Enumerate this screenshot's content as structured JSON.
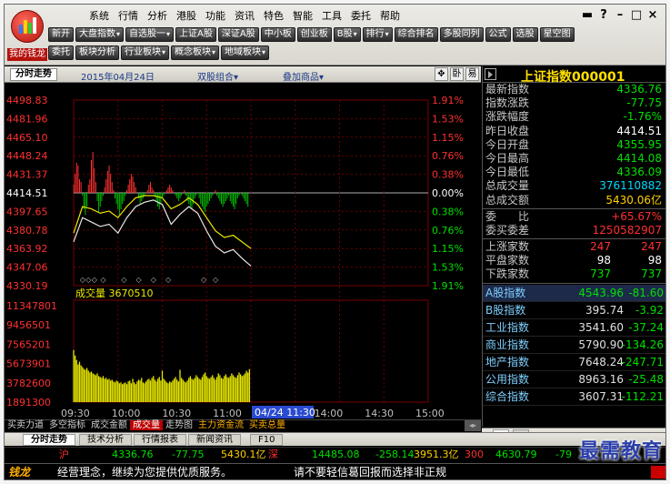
{
  "app": {
    "logo_label": "我的钱龙",
    "menu": [
      "系统",
      "行情",
      "分析",
      "港股",
      "功能",
      "资讯",
      "特色",
      "智能",
      "工具",
      "委托",
      "帮助"
    ],
    "window_controls": [
      "▬",
      "?",
      "–",
      "□",
      "×"
    ]
  },
  "toolbar": {
    "row1": [
      {
        "label": "新开",
        "dd": false
      },
      {
        "label": "大盘指数",
        "dd": true
      },
      {
        "label": "自选股一",
        "dd": true
      },
      {
        "label": "上证A股",
        "dd": false
      },
      {
        "label": "深证A股",
        "dd": false
      },
      {
        "label": "中小板",
        "dd": false
      },
      {
        "label": "创业板",
        "dd": false
      },
      {
        "label": "B股",
        "dd": true
      },
      {
        "label": "排行",
        "dd": true
      },
      {
        "label": "综合排名",
        "dd": false
      },
      {
        "label": "多股同列",
        "dd": false
      },
      {
        "label": "公式",
        "dd": false
      },
      {
        "label": "选股",
        "dd": false
      },
      {
        "label": "星空图",
        "dd": false
      }
    ],
    "row2": [
      {
        "label": "委托",
        "dd": false
      },
      {
        "label": "板块分析",
        "dd": false
      },
      {
        "label": "行业板块",
        "dd": true
      },
      {
        "label": "概念板块",
        "dd": true
      },
      {
        "label": "地域板块",
        "dd": true
      }
    ]
  },
  "chart_header": {
    "tab": "分时走势",
    "date": "2015年04月24日",
    "combo": "双股组合",
    "overlay": "叠加商品",
    "icons": [
      "✥",
      "卧",
      "易"
    ]
  },
  "chart_data": {
    "type": "line",
    "price_labels": [
      "4498.83",
      "4481.96",
      "4465.10",
      "4448.24",
      "4431.37",
      "4414.51",
      "4397.65",
      "4380.78",
      "4363.92",
      "4347.06",
      "4330.19"
    ],
    "pct_labels": [
      "1.91%",
      "1.53%",
      "1.15%",
      "0.76%",
      "0.38%",
      "0.00%",
      "0.38%",
      "0.76%",
      "1.15%",
      "1.53%",
      "1.91%"
    ],
    "volume_labels": [
      "11347801",
      "9456501",
      "7565201",
      "5673901",
      "3782600",
      "1891300"
    ],
    "volume_title": "成交量",
    "volume_value_text": "成交量 3670510",
    "x_labels": [
      "09:30",
      "10:00",
      "10:30",
      "11:00",
      "11:30",
      "14:00",
      "14:30",
      "15:00"
    ],
    "highlight_time": "04/24 11:30",
    "prev_close": 4414.51,
    "y_range": [
      4330.19,
      4498.83
    ],
    "volume_range": [
      0,
      11347801
    ],
    "colors": {
      "price": "#e8e8e8",
      "avg": "#e8e800",
      "up": "#ff3030",
      "down": "#00c000",
      "volume": "#e8e800",
      "flat": "#ffffff"
    },
    "series": [
      {
        "x": [
          0,
          6,
          12,
          18,
          24,
          30,
          36,
          42,
          48,
          54,
          60,
          66,
          72,
          78,
          84,
          90,
          96,
          102,
          108,
          114,
          120
        ],
        "values": [
          4370,
          4392,
          4388,
          4384,
          4386,
          4378,
          4392,
          4402,
          4406,
          4408,
          4404,
          4386,
          4395,
          4402,
          4396,
          4380,
          4366,
          4360,
          4363,
          4355,
          4348
        ]
      },
      {
        "x": [
          0,
          6,
          12,
          18,
          24,
          30,
          36,
          42,
          48,
          54,
          60,
          66,
          72,
          78,
          84,
          90,
          96,
          102,
          108,
          114,
          120
        ],
        "values": [
          4378,
          4402,
          4400,
          4396,
          4398,
          4392,
          4402,
          4410,
          4412,
          4412,
          4410,
          4400,
          4404,
          4410,
          4404,
          4392,
          4380,
          4374,
          4376,
          4370,
          4364
        ]
      }
    ],
    "diff_bars": [
      6,
      14,
      22,
      20,
      10,
      8,
      -2,
      -12,
      -16,
      -10,
      6,
      10,
      24,
      30,
      18,
      8,
      -6,
      -14,
      -10,
      -6,
      -2,
      4,
      10,
      16,
      20,
      14,
      8,
      2,
      -4,
      -8,
      -12,
      -16,
      -12,
      -8,
      -6,
      -2,
      2,
      6,
      10,
      14,
      12,
      8,
      4,
      0,
      -4,
      -8,
      -6,
      -4,
      -2,
      0,
      2,
      6,
      8,
      4,
      2,
      -2,
      -6,
      -10,
      -12,
      -8,
      -4,
      -2,
      0,
      2,
      4,
      6,
      4,
      2,
      0,
      -2,
      -4,
      -6,
      -4,
      -2,
      0,
      2,
      -2,
      -6,
      -8,
      -10,
      -12,
      -8,
      -4,
      -2,
      0,
      -4,
      -8,
      -10,
      -12,
      -14,
      -10,
      -8,
      -6,
      -4,
      -2,
      0,
      2,
      -2,
      -4,
      -6,
      -8,
      -10,
      -8,
      -6,
      -4,
      -2,
      -6,
      -8,
      -10,
      -12,
      -8,
      -4,
      -2,
      0,
      -2,
      -4,
      -6,
      -8,
      -10
    ],
    "volumes": [
      5800000,
      5200000,
      4700000,
      4200000,
      4500000,
      4100000,
      3900000,
      3700000,
      3600000,
      3800000,
      3500000,
      3300000,
      3400000,
      3200000,
      3100000,
      3000000,
      3200000,
      2900000,
      2800000,
      2700000,
      2900000,
      2600000,
      2700000,
      2500000,
      2600000,
      2400000,
      2500000,
      2300000,
      2200000,
      2400000,
      2300000,
      2100000,
      2200000,
      2000000,
      2100000,
      2200000,
      2000000,
      2300000,
      2400000,
      2100000,
      2600000,
      2200000,
      2000000,
      2300000,
      2500000,
      2400000,
      2700000,
      2200000,
      2100000,
      2300000,
      2500000,
      2600000,
      2400000,
      2700000,
      2900000,
      2500000,
      2300000,
      2600000,
      2800000,
      2400000,
      3500000,
      2600000,
      2400000,
      2200000,
      2100000,
      2300000,
      2200000,
      2400000,
      2600000,
      2800000,
      2500000,
      2300000,
      3600000,
      2700000,
      2500000,
      2300000,
      2200000,
      2400000,
      2700000,
      2900000,
      2600000,
      2500000,
      2700000,
      3000000,
      2800000,
      2600000,
      2500000,
      2800000,
      3100000,
      3300000,
      2900000,
      2700000,
      2600000,
      2800000,
      3000000,
      2700000,
      2500000,
      2800000,
      3200000,
      3000000,
      2700000,
      2600000,
      2900000,
      3100000,
      2800000,
      2700000,
      2900000,
      3200000,
      3000000,
      2800000,
      2700000,
      3000000,
      3300000,
      3100000,
      2900000,
      3000000,
      3200000,
      3500000,
      3300000,
      3670510
    ],
    "markers": [
      6,
      10,
      14,
      20,
      34,
      44,
      54,
      64,
      88,
      96
    ]
  },
  "panel": {
    "title": "上证指数",
    "code": "000001",
    "quote": [
      {
        "k": "最新指数",
        "v": "4336.76",
        "c": "#00e000"
      },
      {
        "k": "指数涨跌",
        "v": "-77.75",
        "c": "#00e000"
      },
      {
        "k": "涨跌幅度",
        "v": "-1.76%",
        "c": "#00e000"
      },
      {
        "k": "昨日收盘",
        "v": "4414.51",
        "c": "#ffffff"
      },
      {
        "k": "今日开盘",
        "v": "4355.95",
        "c": "#00e000"
      },
      {
        "k": "今日最高",
        "v": "4414.08",
        "c": "#00e000"
      },
      {
        "k": "今日最低",
        "v": "4336.09",
        "c": "#00e000"
      },
      {
        "k": "总成交量",
        "v": "376110882",
        "c": "#00d8ff"
      },
      {
        "k": "总成交额",
        "v": "5430.06亿",
        "c": "#ffd000"
      }
    ],
    "order": [
      {
        "k": "委　　比",
        "v": "+65.67%",
        "c": "#ff3030"
      },
      {
        "k": "委买委差",
        "v": "1250582907",
        "c": "#ff3030"
      }
    ],
    "breadth": [
      {
        "k": "上涨家数",
        "a": "247",
        "b": "247",
        "c": "#ff3030"
      },
      {
        "k": "平盘家数",
        "a": "98",
        "b": "98",
        "c": "#ffffff"
      },
      {
        "k": "下跌家数",
        "a": "737",
        "b": "737",
        "c": "#00e000"
      }
    ],
    "indices": [
      {
        "k": "A股指数",
        "a": "4543.96",
        "b": "-81.60"
      },
      {
        "k": "B股指数",
        "a": "395.74",
        "b": "-3.92"
      },
      {
        "k": "工业指数",
        "a": "3541.60",
        "b": "-37.24"
      },
      {
        "k": "商业指数",
        "a": "5790.90",
        "b": "-134.26"
      },
      {
        "k": "地产指数",
        "a": "7648.24",
        "b": "-247.71"
      },
      {
        "k": "公用指数",
        "a": "8963.16",
        "b": "-25.48"
      },
      {
        "k": "综合指数",
        "a": "3607.31",
        "b": "-112.21"
      }
    ],
    "tabs": [
      "指",
      "关"
    ]
  },
  "indicator_tabs": [
    "买卖力道",
    "多空指标",
    "成交金额",
    "成交量",
    "走势图",
    "主力资金流",
    "买卖总量"
  ],
  "indicator_active": "成交量",
  "main_tabs": [
    "分时走势",
    "技术分析",
    "行情报表",
    "新闻资讯",
    "F10"
  ],
  "ticker": {
    "name1": "沪",
    "p1": "4336.76",
    "c1": "-77.75",
    "amt1": "5430.1亿",
    "name2": "深",
    "p2": "14485.08",
    "c2": "-258.14",
    "amt2": "3951.3亿",
    "name3": "300",
    "p3": "4630.79",
    "c3": "-79"
  },
  "status": {
    "brand": "钱龙",
    "msg": "经营理念，继续为您提供优质服务。",
    "msg2": "请不要轻信葛回报而选择非正规"
  },
  "watermark": "最需教育"
}
